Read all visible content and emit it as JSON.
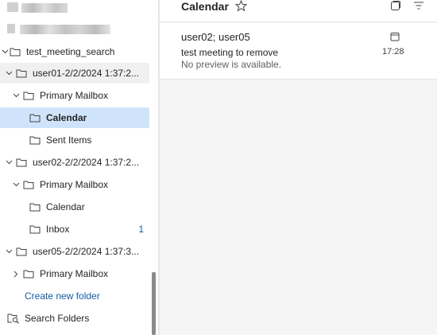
{
  "sidebar": {
    "root_folder": "test_meeting_search",
    "items": [
      {
        "label": "user01-2/2/2024 1:37:2...",
        "count": ""
      },
      {
        "label": "Primary Mailbox",
        "count": ""
      },
      {
        "label": "Calendar",
        "count": ""
      },
      {
        "label": "Sent Items",
        "count": ""
      },
      {
        "label": "user02-2/2/2024 1:37:2...",
        "count": ""
      },
      {
        "label": "Primary Mailbox",
        "count": ""
      },
      {
        "label": "Calendar",
        "count": ""
      },
      {
        "label": "Inbox",
        "count": "1"
      },
      {
        "label": "user05-2/2/2024 1:37:3...",
        "count": ""
      },
      {
        "label": "Primary Mailbox",
        "count": ""
      }
    ],
    "create_new_folder": "Create new folder",
    "search_folders": "Search Folders"
  },
  "pane": {
    "title": "Calendar"
  },
  "message": {
    "from": "user02; user05",
    "subject": "test meeting to remove",
    "preview": "No preview is available.",
    "time": "17:28"
  },
  "colors": {
    "selected_bg": "#cfe4fa",
    "link": "#115ea3",
    "pane_bg": "#f5f5f5"
  }
}
